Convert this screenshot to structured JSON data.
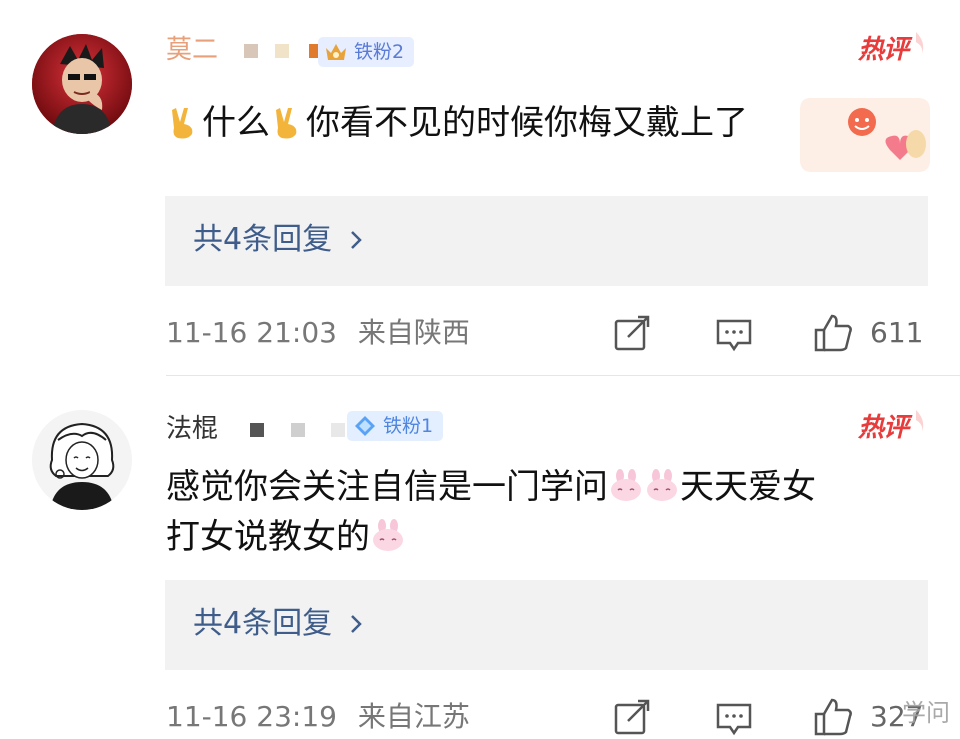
{
  "comments": [
    {
      "username_visible": "莫二",
      "fan_badge": "铁粉2",
      "hot_label": "热评",
      "text_parts": [
        "什么",
        "你看不见的时候你梅又戴上了"
      ],
      "replies_label": "共4条回复",
      "timestamp": "11-16 21:03",
      "location": "来自陕西",
      "likes": "611"
    },
    {
      "username_visible": "法棍",
      "fan_badge": "铁粉1",
      "hot_label": "热评",
      "text_part1": "感觉你会关注自信是一门学问",
      "text_part2": "天天爱女",
      "text_part3": "打女说教女的",
      "replies_label": "共4条回复",
      "timestamp": "11-16 23:19",
      "location": "来自江苏",
      "likes": "327"
    }
  ],
  "watermark": "学问",
  "colors": {
    "link": "#3f5d8a",
    "hot": "#e83b3b",
    "reply_bg": "#f2f2f2",
    "meta": "#777777"
  },
  "icons": {
    "share": "share-edit-icon",
    "reply": "comment-bubble-icon",
    "like": "thumbs-up-icon",
    "chevron": "chevron-right-icon"
  }
}
